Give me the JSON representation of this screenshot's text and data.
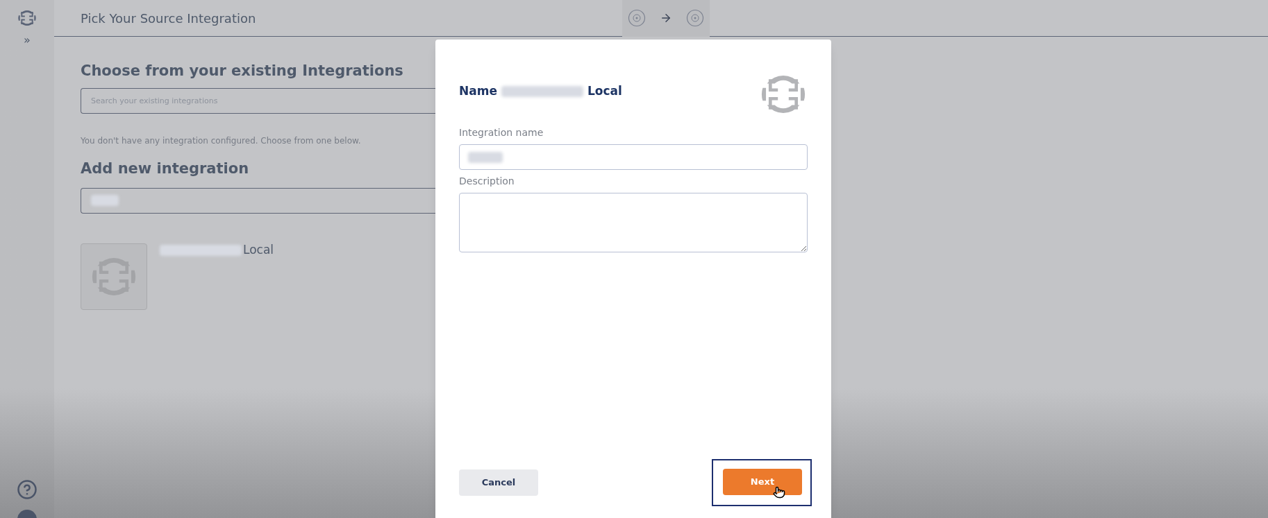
{
  "sidebar": {
    "expand_label": "»"
  },
  "header": {
    "title": "Pick Your Source Integration"
  },
  "existing": {
    "heading": "Choose from your existing Integrations",
    "search": {
      "placeholder": "Search your existing integrations"
    },
    "empty_message": "You don't have any integration configured. Choose from one below."
  },
  "add_new": {
    "heading": "Add new integration",
    "cards": [
      {
        "label": "Local"
      }
    ]
  },
  "dialog": {
    "title_prefix": "Name",
    "title_suffix": "Local",
    "fields": [
      {
        "kind": "input",
        "label": "Integration name"
      },
      {
        "kind": "textarea",
        "label": "Description"
      }
    ],
    "buttons": [
      {
        "label": "Cancel",
        "kind": "secondary",
        "focused": false
      },
      {
        "label": "Next",
        "kind": "primary",
        "focused": true
      }
    ]
  }
}
